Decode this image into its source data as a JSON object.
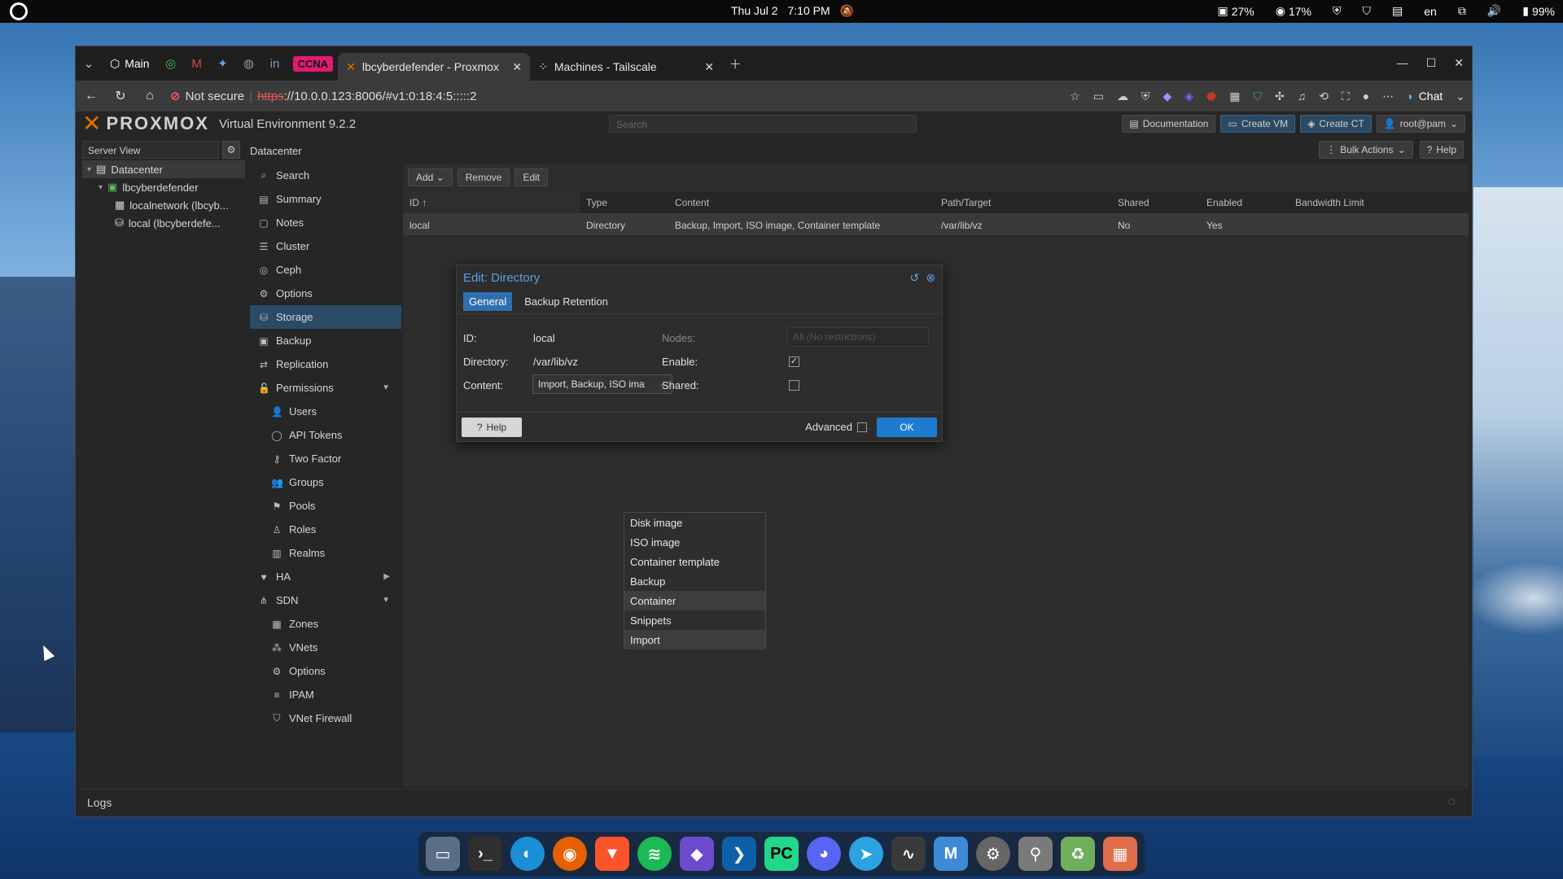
{
  "system_bar": {
    "date": "Thu Jul 2",
    "time": "7:10 PM",
    "cpu": "27%",
    "mem": "17%",
    "lang": "en",
    "battery": "99%"
  },
  "browser": {
    "tabs": [
      {
        "label": "Main"
      },
      {
        "label": "CCNA"
      },
      {
        "label": "lbcyberdefender - Proxmox"
      },
      {
        "label": "Machines - Tailscale"
      }
    ],
    "not_secure": "Not secure",
    "url_proto": "https",
    "url_rest": "://10.0.0.123:8006/#v1:0:18:4:5:::::2",
    "chat_label": "Chat"
  },
  "pve": {
    "logo_word": "PROXMOX",
    "version": "Virtual Environment 9.2.2",
    "search_placeholder": "Search",
    "header_buttons": {
      "docs": "Documentation",
      "create_vm": "Create VM",
      "create_ct": "Create CT",
      "user": "root@pam"
    },
    "server_view": "Server View",
    "tree": {
      "datacenter": "Datacenter",
      "node": "lbcyberdefender",
      "net": "localnetwork (lbcyb...",
      "storage": "local (lbcyberdefe..."
    },
    "breadcrumb": "Datacenter",
    "bulk_actions": "Bulk Actions",
    "help": "Help",
    "menu": [
      {
        "label": "Search",
        "icon": "search-icon"
      },
      {
        "label": "Summary",
        "icon": "book-icon"
      },
      {
        "label": "Notes",
        "icon": "notes-icon"
      },
      {
        "label": "Cluster",
        "icon": "server-icon"
      },
      {
        "label": "Ceph",
        "icon": "ceph-icon"
      },
      {
        "label": "Options",
        "icon": "gear-icon"
      },
      {
        "label": "Storage",
        "icon": "database-icon"
      },
      {
        "label": "Backup",
        "icon": "floppy-icon"
      },
      {
        "label": "Replication",
        "icon": "retweet-icon"
      },
      {
        "label": "Permissions",
        "icon": "unlock-icon"
      },
      {
        "label": "Users",
        "icon": "user-icon"
      },
      {
        "label": "API Tokens",
        "icon": "user-o-icon"
      },
      {
        "label": "Two Factor",
        "icon": "key-icon"
      },
      {
        "label": "Groups",
        "icon": "users-icon"
      },
      {
        "label": "Pools",
        "icon": "tags-icon"
      },
      {
        "label": "Roles",
        "icon": "male-icon"
      },
      {
        "label": "Realms",
        "icon": "building-icon"
      },
      {
        "label": "HA",
        "icon": "heartbeat-icon"
      },
      {
        "label": "SDN",
        "icon": "sdn-icon"
      },
      {
        "label": "Zones",
        "icon": "th-icon"
      },
      {
        "label": "VNets",
        "icon": "network-icon"
      },
      {
        "label": "Options",
        "icon": "gear-icon"
      },
      {
        "label": "IPAM",
        "icon": "ipam-icon"
      },
      {
        "label": "VNet Firewall",
        "icon": "shield-icon"
      }
    ],
    "toolbar": {
      "add": "Add",
      "remove": "Remove",
      "edit": "Edit"
    },
    "columns": [
      "ID",
      "Type",
      "Content",
      "Path/Target",
      "Shared",
      "Enabled",
      "Bandwidth Limit"
    ],
    "rows": [
      [
        "local",
        "Directory",
        "Backup, Import, ISO image, Container template",
        "/var/lib/vz",
        "No",
        "Yes",
        ""
      ]
    ],
    "logs": "Logs"
  },
  "dialog": {
    "title": "Edit: Directory",
    "tabs": [
      "General",
      "Backup Retention"
    ],
    "id_label": "ID:",
    "id_value": "local",
    "dir_label": "Directory:",
    "dir_value": "/var/lib/vz",
    "content_label": "Content:",
    "content_value": "Import, Backup, ISO ima",
    "nodes_label": "Nodes:",
    "nodes_value": "All (No restrictions)",
    "enable_label": "Enable:",
    "shared_label": "Shared:",
    "help": "Help",
    "advanced": "Advanced",
    "ok": "OK",
    "options": [
      "Disk image",
      "ISO image",
      "Container template",
      "Backup",
      "Container",
      "Snippets",
      "Import"
    ]
  },
  "dock": [
    "files",
    "terminal",
    "edge",
    "firefox",
    "brave",
    "spotify",
    "obsidian",
    "vscode",
    "pycharm",
    "discord",
    "telegram",
    "monitor",
    "settings-app",
    "settings",
    "usb",
    "trash",
    "apps"
  ]
}
